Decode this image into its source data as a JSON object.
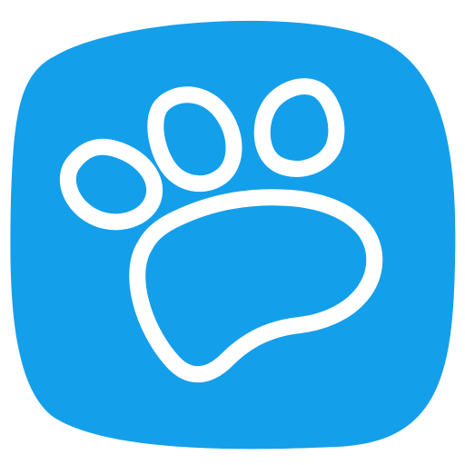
{
  "icon": {
    "name": "paw-print-icon",
    "background_color": "#149FEA",
    "foreground_color": "#FFFFFF"
  }
}
